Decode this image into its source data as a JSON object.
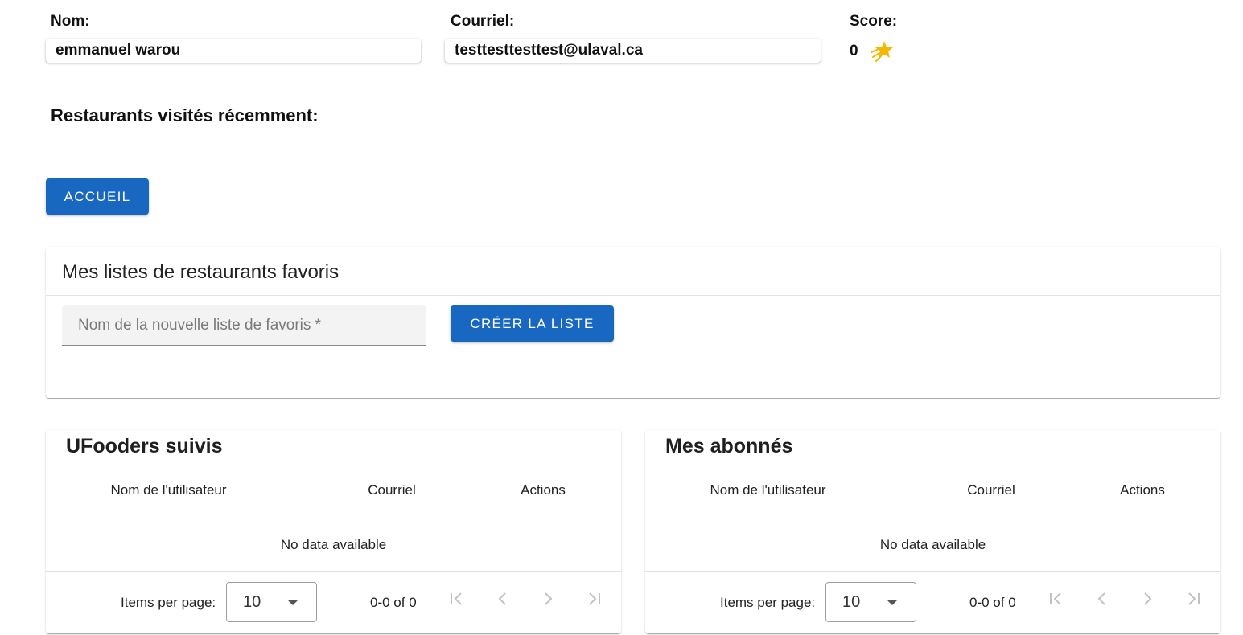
{
  "profile": {
    "name_label": "Nom:",
    "name_value": "emmanuel warou",
    "email_label": "Courriel:",
    "email_value": "testtesttesttest@ulaval.ca",
    "score_label": "Score:",
    "score_value": "0",
    "score_icon": "shooting-star-icon"
  },
  "recent": {
    "title": "Restaurants visités récemment:"
  },
  "home_button": {
    "label": "ACCUEIL"
  },
  "favorites": {
    "title": "Mes listes de restaurants favoris",
    "input_placeholder": "Nom de la nouvelle liste de favoris *",
    "create_label": "CRÉER LA LISTE"
  },
  "following_table": {
    "title": "UFooders suivis",
    "columns": [
      "Nom de l'utilisateur",
      "Courriel",
      "Actions"
    ],
    "empty_text": "No data available",
    "items_per_page_label": "Items per page:",
    "items_per_page_value": "10",
    "range_text": "0-0 of 0"
  },
  "followers_table": {
    "title": "Mes abonnés",
    "columns": [
      "Nom de l'utilisateur",
      "Courriel",
      "Actions"
    ],
    "empty_text": "No data available",
    "items_per_page_label": "Items per page:",
    "items_per_page_value": "10",
    "range_text": "0-0 of 0"
  },
  "colors": {
    "primary": "#1867c0",
    "star": "#f5b800"
  }
}
